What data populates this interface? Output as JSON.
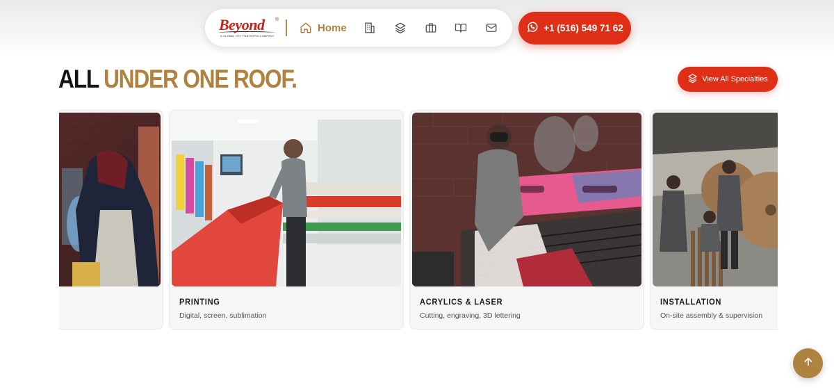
{
  "nav": {
    "logo": {
      "word": "Beyond",
      "tm": "®",
      "tagline": "A GLOBAL KEY PARTNERS COMPANY"
    },
    "home_label": "Home",
    "icons": [
      "building-icon",
      "layers-icon",
      "briefcase-icon",
      "book-icon",
      "mail-icon"
    ]
  },
  "phone": {
    "label": "+1 (516) 549 71 62",
    "icon": "whatsapp-icon"
  },
  "heading": {
    "part1": "ALL ",
    "part2": "UNDER ONE ROOF."
  },
  "specialties_button": {
    "label": "View All Specialties",
    "icon": "layers-icon"
  },
  "cards": [
    {
      "title": "",
      "desc": "",
      "image": "welding-photo"
    },
    {
      "title": "PRINTING",
      "desc": "Digital, screen, sublimation",
      "image": "printing-photo"
    },
    {
      "title": "ACRYLICS & LASER",
      "desc": "Cutting, engraving, 3D lettering",
      "image": "laser-photo"
    },
    {
      "title": "INSTALLATION",
      "desc": "On-site assembly & supervision",
      "image": "installation-photo"
    }
  ],
  "colors": {
    "accent_red": "#e02f17",
    "accent_gold": "#b0823f",
    "logo_red": "#c8221c",
    "text_dark": "#141414"
  },
  "scroll_top": {
    "icon": "arrow-up-icon"
  }
}
